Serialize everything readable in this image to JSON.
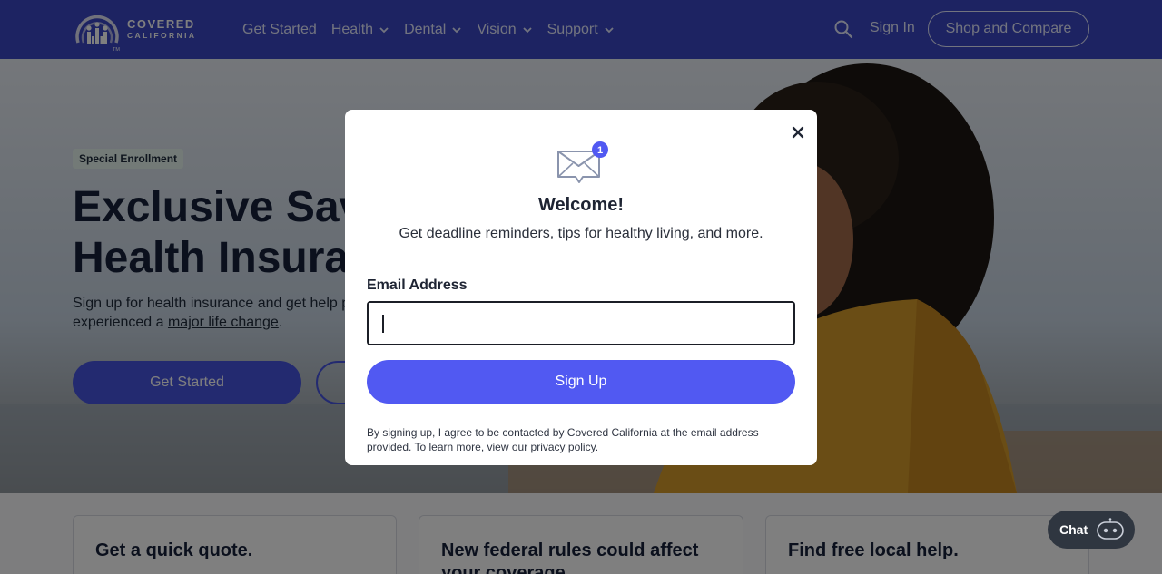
{
  "header": {
    "logo_line1": "COVERED",
    "logo_line2": "CALIFORNIA",
    "logo_tm": "TM",
    "nav": [
      {
        "label": "Get Started",
        "has_dropdown": false
      },
      {
        "label": "Health",
        "has_dropdown": true
      },
      {
        "label": "Dental",
        "has_dropdown": true
      },
      {
        "label": "Vision",
        "has_dropdown": true
      },
      {
        "label": "Support",
        "has_dropdown": true
      }
    ],
    "search_icon": "search-icon",
    "sign_in": "Sign In",
    "shop_compare": "Shop and Compare",
    "bg_color": "#3b47c4"
  },
  "hero": {
    "badge": "Special Enrollment",
    "title_line1": "Exclusive Savi",
    "title_line2": "Health Insurar",
    "sub_text": "Sign up for health insurance and get help p",
    "sub_text2": "experienced a ",
    "sub_link": "major life change",
    "sub_end": ".",
    "primary_button": "Get Started",
    "primary_color": "#4755e0"
  },
  "cards": [
    {
      "title": "Get a quick quote."
    },
    {
      "title": "New federal rules could affect your coverage."
    },
    {
      "title": "Find free local help."
    }
  ],
  "chat": {
    "label": "Chat",
    "icon": "chat-bot-icon"
  },
  "modal": {
    "close_icon": "close-icon",
    "envelope_icon": "envelope-icon",
    "notification_count": "1",
    "title": "Welcome!",
    "description": "Get deadline reminders, tips for healthy living, and more.",
    "email_label": "Email Address",
    "email_value": "",
    "email_placeholder": "",
    "signup_button": "Sign Up",
    "legal_text": "By signing up, I agree to be contacted by Covered California at the email address provided. To learn more, view our ",
    "privacy_link": "privacy policy",
    "legal_end": ".",
    "button_color": "#5159f2"
  }
}
